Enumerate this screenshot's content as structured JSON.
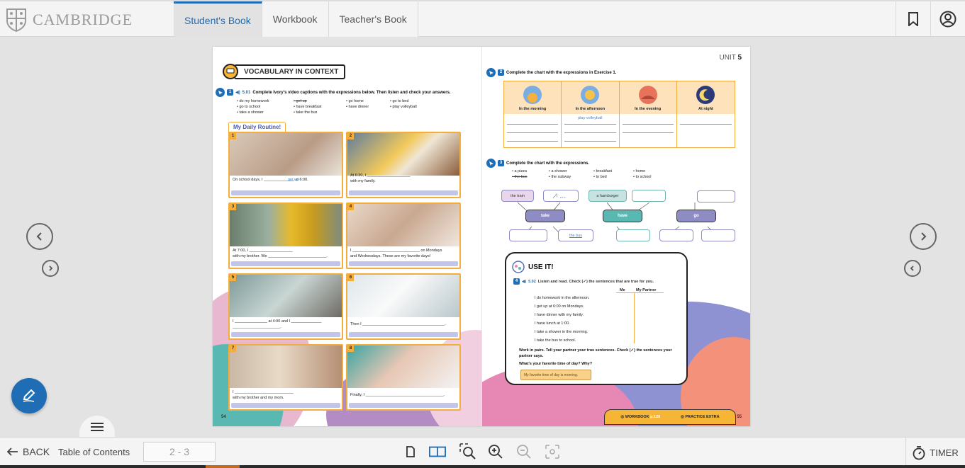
{
  "header": {
    "brand": "CAMBRIDGE",
    "tabs": [
      {
        "label": "Student's Book",
        "active": true
      },
      {
        "label": "Workbook",
        "active": false
      },
      {
        "label": "Teacher's Book",
        "active": false
      }
    ],
    "icons": [
      "bookmark-icon",
      "user-account-icon"
    ]
  },
  "colors": {
    "accent": "#1f6db5",
    "orange": "#f3ad3d"
  },
  "book": {
    "left_page": {
      "section_title": "VOCABULARY IN CONTEXT",
      "exercise1": {
        "number": "1",
        "track": "5.01",
        "instruction": "Complete Ivory's video captions with the expressions below. Then listen and check your answers.",
        "expressions": [
          "• do my homework",
          "• get up",
          "• go home",
          "• go to bed",
          "• go to school",
          "• have breakfast",
          "• have dinner",
          "• play volleyball",
          "• take a shower",
          "• take the bus"
        ]
      },
      "routine_label": "My Daily Routine!",
      "cards": [
        {
          "num": "1",
          "line1": "On school days, I ______________ at 6:00.",
          "answer": "get up"
        },
        {
          "num": "2",
          "line1": "At 6:30, I ____________________",
          "line2": "with my family."
        },
        {
          "num": "3",
          "line1": "At 7:00, I ____________________",
          "line2": "with my brother. We ___________________________."
        },
        {
          "num": "4",
          "line1": "I _______________________________ on Mondays",
          "line2": "and Wednesdays. These are my favorite days!"
        },
        {
          "num": "5",
          "line1": "I _______________ at 4:00 and I ______________",
          "line2": "______________________."
        },
        {
          "num": "6",
          "line1": "Then I ______________________________________."
        },
        {
          "num": "7",
          "line1": "I ___________________________",
          "line2": "with my brother and my mom."
        },
        {
          "num": "8",
          "line1": "Finally, I ____________________________________."
        }
      ],
      "page_number": "54"
    },
    "right_page": {
      "unit_label": "UNIT",
      "unit_number": "5",
      "exercise2": {
        "number": "2",
        "instruction": "Complete the chart with the expressions in Exercise 1.",
        "columns": [
          "In the morning",
          "In the afternoon",
          "In the evening",
          "At night"
        ],
        "sample_answer": "play volleyball"
      },
      "exercise3": {
        "number": "3",
        "instruction": "Complete the chart with the expressions.",
        "expressions": [
          "• a pizza",
          "• a shower",
          "• breakfast",
          "• home",
          "• the bus",
          "• the subway",
          "• to bed",
          "• to school"
        ],
        "map": {
          "the_train": "the train",
          "take": "take",
          "the_bus": "the bus",
          "a_hamburger": "a hamburger",
          "have": "have",
          "go": "go"
        }
      },
      "use_it": {
        "title": "USE IT!",
        "number": "4",
        "track": "5.02",
        "instruction": "Listen and read. Check (✓) the sentences that are true for you.",
        "col_me": "Me",
        "col_partner": "My Partner",
        "sentences": [
          "I do homework in the afternoon.",
          "I get up at 6:00 on Mondays.",
          "I have dinner with my family.",
          "I have lunch at 1:00.",
          "I take a shower in the morning.",
          "I take the bus to school."
        ],
        "pair_work": "Work in pairs. Tell your partner your true sentences. Check (✓) the sentences your partner says.",
        "question": "What's your favorite time of day? Why?",
        "bubble": "My favorite time of day is morning."
      },
      "footer": {
        "workbook": "WORKBOOK",
        "workbook_page": "p.129",
        "practice": "PRACTICE EXTRA"
      },
      "page_number": "55"
    }
  },
  "bottom": {
    "back_label": "BACK",
    "toc_label": "Table of Contents",
    "page_range": "2 - 3",
    "timer_label": "TIMER"
  }
}
